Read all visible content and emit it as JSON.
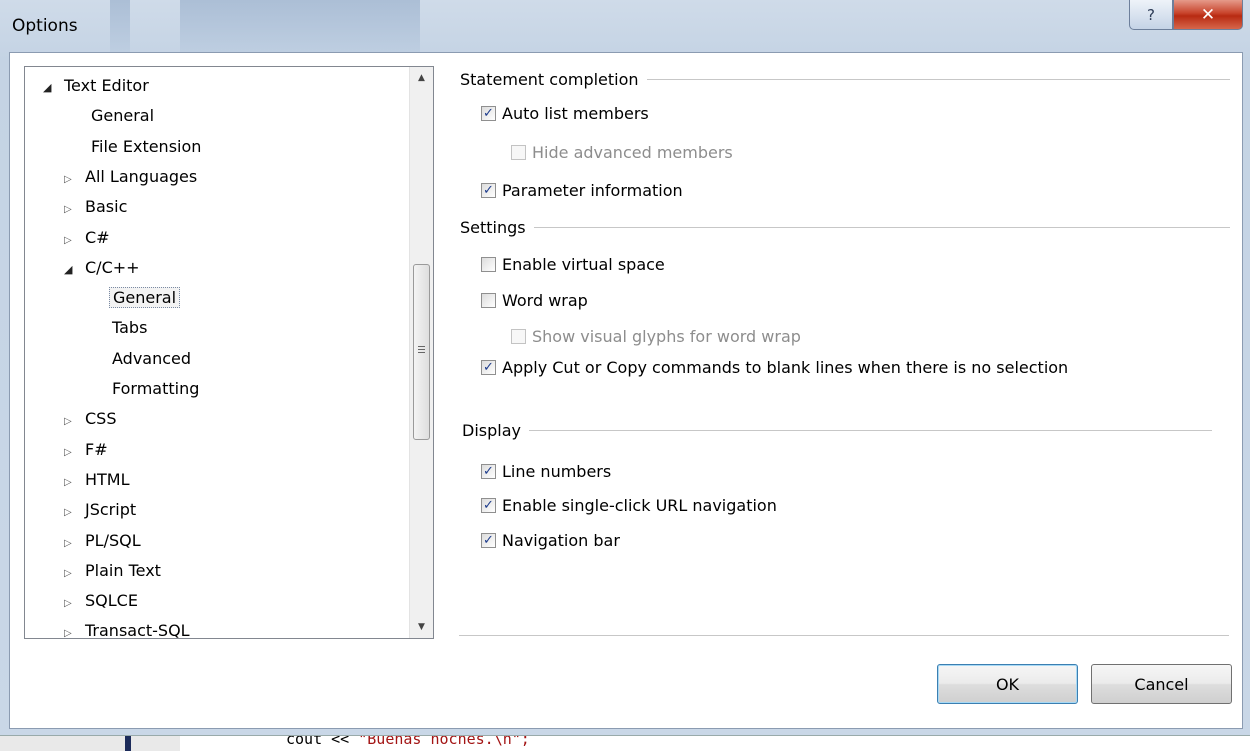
{
  "window": {
    "title": "Options",
    "help_glyph": "?",
    "close_glyph": "✕"
  },
  "tree": {
    "items": [
      {
        "label": "Text Editor",
        "expander": "expanded"
      },
      {
        "label": "General",
        "expander": "none"
      },
      {
        "label": "File Extension",
        "expander": "none"
      },
      {
        "label": "All Languages",
        "expander": "collapsed"
      },
      {
        "label": "Basic",
        "expander": "collapsed"
      },
      {
        "label": "C#",
        "expander": "collapsed"
      },
      {
        "label": "C/C++",
        "expander": "expanded"
      },
      {
        "label": "General",
        "expander": "none",
        "selected": true
      },
      {
        "label": "Tabs",
        "expander": "none"
      },
      {
        "label": "Advanced",
        "expander": "none"
      },
      {
        "label": "Formatting",
        "expander": "none"
      },
      {
        "label": "CSS",
        "expander": "collapsed"
      },
      {
        "label": "F#",
        "expander": "collapsed"
      },
      {
        "label": "HTML",
        "expander": "collapsed"
      },
      {
        "label": "JScript",
        "expander": "collapsed"
      },
      {
        "label": "PL/SQL",
        "expander": "collapsed"
      },
      {
        "label": "Plain Text",
        "expander": "collapsed"
      },
      {
        "label": "SQLCE",
        "expander": "collapsed"
      },
      {
        "label": "Transact-SQL",
        "expander": "collapsed"
      }
    ],
    "grip_glyph": "≡"
  },
  "options": {
    "statement_completion": {
      "header": "Statement completion",
      "auto_list_members": {
        "label": "Auto list members",
        "checked": true
      },
      "hide_advanced_members": {
        "label": "Hide advanced members",
        "checked": false,
        "disabled": true
      },
      "parameter_information": {
        "label": "Parameter information",
        "checked": true
      }
    },
    "settings": {
      "header": "Settings",
      "enable_virtual_space": {
        "label": "Enable virtual space",
        "checked": false
      },
      "word_wrap": {
        "label": "Word wrap",
        "checked": false
      },
      "show_visual_glyphs": {
        "label": "Show visual glyphs for word wrap",
        "checked": false,
        "disabled": true
      },
      "apply_cut_copy": {
        "label": "Apply Cut or Copy commands to blank lines when there is no selection",
        "checked": true
      }
    },
    "display": {
      "header": "Display",
      "line_numbers": {
        "label": "Line numbers",
        "checked": true
      },
      "single_click_url": {
        "label": "Enable single-click URL navigation",
        "checked": true
      },
      "navigation_bar": {
        "label": "Navigation bar",
        "checked": true
      }
    }
  },
  "buttons": {
    "ok": "OK",
    "cancel": "Cancel"
  },
  "background_code": {
    "prefix": "cout << ",
    "string": "\"Buenas noches.\\n\";"
  },
  "colors": {
    "check_mark": "#1f3d8c",
    "close_button": "#c8442c",
    "ok_focus_border": "#3c7fb1"
  }
}
